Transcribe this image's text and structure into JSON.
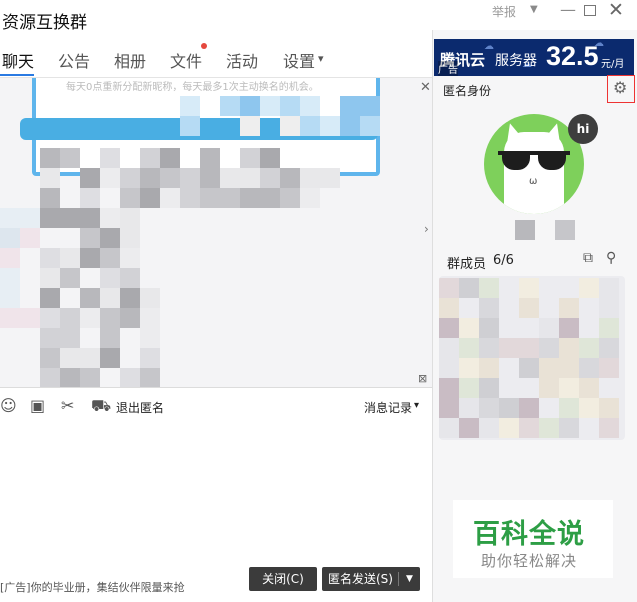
{
  "window": {
    "title": "资源互换群",
    "report": "举报",
    "dropdown_glyph": "▼",
    "minimize_glyph": "—",
    "close_glyph": "✕"
  },
  "tabs": [
    {
      "label": "聊天",
      "active": true
    },
    {
      "label": "公告",
      "active": false
    },
    {
      "label": "相册",
      "active": false
    },
    {
      "label": "文件",
      "active": false,
      "badge": true
    },
    {
      "label": "活动",
      "active": false
    },
    {
      "label": "设置",
      "active": false,
      "dropdown": "▾"
    }
  ],
  "chat": {
    "notice_text": "每天0点重新分配新昵称，每天最多1次主动换名的机会。",
    "collapse_glyph": "✕"
  },
  "toolbar": {
    "exit_anon": "退出匿名",
    "history": "消息记录",
    "history_arrow": "▾"
  },
  "bottom": {
    "ad_text": "[广告]你的毕业册，集结伙伴限量来抢",
    "close_button": "关闭(C)",
    "send_button": "匿名发送(S)",
    "send_arrow": "▼"
  },
  "ad_banner": {
    "brand": "腾讯云",
    "tag": "广告",
    "product": "服务器",
    "price": "32.5",
    "unit": "元/月"
  },
  "right": {
    "anon_identity": "匿名身份",
    "hi": "hi",
    "members_label": "群成员",
    "members_count": "6/6"
  },
  "watermark": {
    "title": "百科全说",
    "subtitle": "助你轻松解决"
  },
  "colors": {
    "accent_blue": "#2a7ae2",
    "badge_red": "#e5483e",
    "ad_navy": "#0b2a6e",
    "avatar_green": "#7ed05b",
    "watermark_green": "#2d9e45"
  }
}
